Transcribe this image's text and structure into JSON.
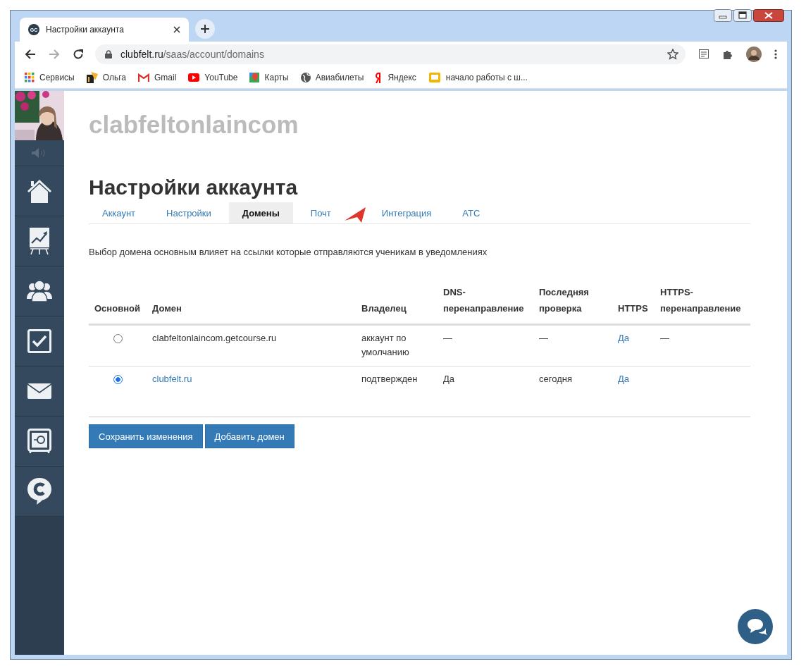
{
  "browser": {
    "tab_title": "Настройки аккаунта",
    "favicon": "GC",
    "url_host": "clubfelt.ru",
    "url_path": "/saas/account/domains",
    "bookmarks": [
      {
        "kind": "apps",
        "label": "Сервисы"
      },
      {
        "kind": "custom",
        "label": "Ольга"
      },
      {
        "kind": "gmail",
        "label": "Gmail"
      },
      {
        "kind": "youtube",
        "label": "YouTube"
      },
      {
        "kind": "maps",
        "label": "Карты"
      },
      {
        "kind": "globe",
        "label": "Авиабилеты"
      },
      {
        "kind": "yandex",
        "label": "Яндекс"
      },
      {
        "kind": "folder",
        "label": "начало работы с ш..."
      }
    ]
  },
  "sidebar": {
    "items": [
      {
        "kind": "sound"
      },
      {
        "kind": "home"
      },
      {
        "kind": "chart"
      },
      {
        "kind": "users"
      },
      {
        "kind": "tasks"
      },
      {
        "kind": "mail"
      },
      {
        "kind": "safe"
      },
      {
        "kind": "chat"
      }
    ]
  },
  "page": {
    "site_title": "clabfeltonlaincom",
    "heading": "Настройки аккаунта",
    "tabs": [
      {
        "label": "Аккаунт",
        "selected": false
      },
      {
        "label": "Настройки",
        "selected": false
      },
      {
        "label": "Домены",
        "selected": true
      },
      {
        "label": "Почт",
        "selected": false
      },
      {
        "label": "Интеграция",
        "selected": false
      },
      {
        "label": "АТС",
        "selected": false
      }
    ],
    "description": "Выбор домена основным влияет на ссылки которые отправляются ученикам в уведомлениях",
    "table": {
      "columns": [
        "Основной",
        "Домен",
        "Владелец",
        "DNS-перенаправление",
        "Последняя проверка",
        "HTTPS",
        "HTTPS-перенаправление"
      ],
      "rows": [
        {
          "cells": [
            {
              "kind": "radio",
              "selected": false
            },
            {
              "text": "clabfeltonlaincom.getcourse.ru",
              "link": false
            },
            {
              "text": "аккаунт по умолчанию",
              "link": false
            },
            {
              "text": "—",
              "link": false
            },
            {
              "text": "—",
              "link": false
            },
            {
              "text": "Да",
              "link": true
            },
            {
              "text": "—",
              "link": false
            }
          ]
        },
        {
          "cells": [
            {
              "kind": "radio",
              "selected": true
            },
            {
              "text": "clubfelt.ru",
              "link": true
            },
            {
              "text": "подтвержден",
              "link": false
            },
            {
              "text": "Да",
              "link": false
            },
            {
              "text": "сегодня",
              "link": false
            },
            {
              "text": "Да",
              "link": true
            }
          ]
        }
      ]
    },
    "buttons": [
      "Сохранить изменения",
      "Добавить домен"
    ]
  }
}
